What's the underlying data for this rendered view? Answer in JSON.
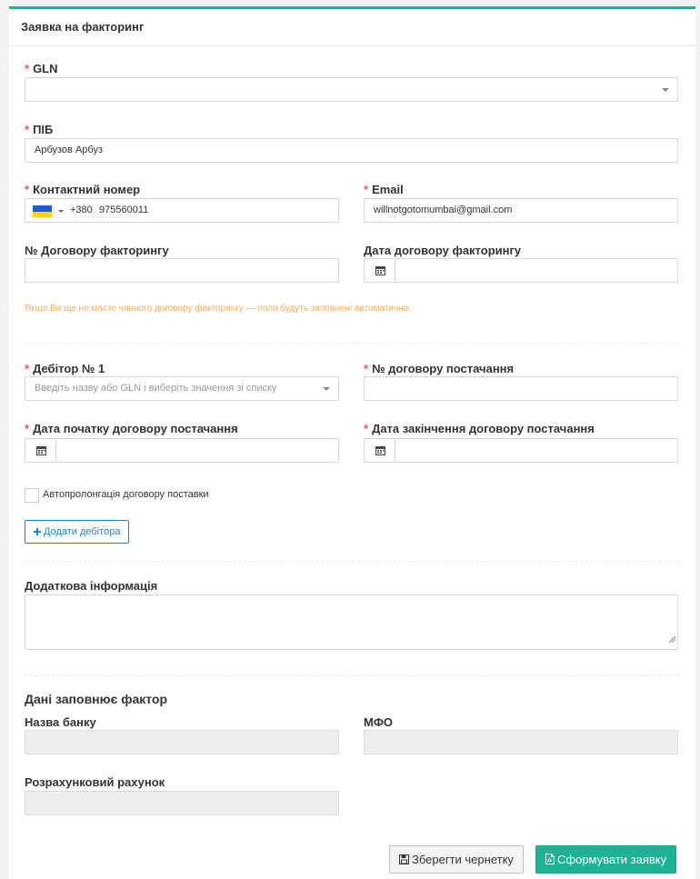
{
  "form": {
    "title": "Заявка на факторинг",
    "gln": {
      "label": "GLN",
      "value": ""
    },
    "pib": {
      "label": "ПІБ",
      "value": "Арбузов Арбуз"
    },
    "phone": {
      "label": "Контактний номер",
      "dial_code": "+380",
      "value": "975560011"
    },
    "email": {
      "label": "Email",
      "value": "willnotgotomumbai@gmail.com"
    },
    "contract_number": {
      "label": "№ Договору факторингу",
      "value": ""
    },
    "contract_date": {
      "label": "Дата договору факторингу",
      "value": ""
    },
    "hint": "Якщо Ви ще не маєте чинного договору факторингу — поля будуть заповнені автоматично.",
    "debtor": {
      "label": "Дебітор № 1",
      "placeholder": "Введіть назву або GLN і виберіть значення зі списку"
    },
    "supply_contract_number": {
      "label": "№ договору постачання",
      "value": ""
    },
    "supply_start": {
      "label": "Дата початку договору постачання",
      "value": ""
    },
    "supply_end": {
      "label": "Дата закінчення договору постачання",
      "value": ""
    },
    "autoprolong": {
      "label": "Автопролонгація договору поставки",
      "checked": false
    },
    "add_debtor_label": "Додати дебітора",
    "additional_info": {
      "label": "Додаткова інформація",
      "value": ""
    },
    "factor_section": {
      "title": "Дані заповнює фактор",
      "bank_name": {
        "label": "Назва банку",
        "value": ""
      },
      "mfo": {
        "label": "МФО",
        "value": ""
      },
      "account": {
        "label": "Розрахунковий рахунок",
        "value": ""
      }
    },
    "buttons": {
      "save_draft": "Зберегти чернетку",
      "submit": "Сформувати заявку"
    }
  },
  "colors": {
    "accent": "#1ab394",
    "required": "#ed5565",
    "hint": "#f8ac59",
    "link": "#1c84c6"
  },
  "icons": {
    "calendar": "calendar-icon",
    "plus": "plus-icon",
    "save": "floppy-icon",
    "file": "file-pdf-icon"
  }
}
